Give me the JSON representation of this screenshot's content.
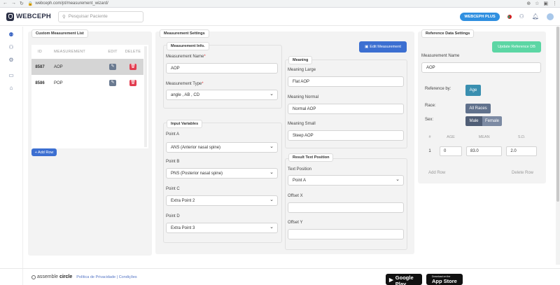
{
  "browser": {
    "url": "webceph.com/pt/measurement_wizard/"
  },
  "header": {
    "logo": "WEBCEPH",
    "search_placeholder": "Pesquisar Paciente",
    "plus_badge": "WEBCEPH PLUS"
  },
  "custom_list": {
    "title": "Custom Measurement List",
    "columns": [
      "ID",
      "MEASUREMENT",
      "EDIT",
      "DELETE"
    ],
    "rows": [
      {
        "id": "8587",
        "name": "AOP"
      },
      {
        "id": "8586",
        "name": "POP"
      }
    ],
    "add_row": "+ Add Row"
  },
  "settings": {
    "title": "Measurement Settings",
    "edit_button": "Edit Measurement",
    "info": {
      "title": "Measurement Info.",
      "name_label": "Measurement Name",
      "name_value": "AOP",
      "type_label": "Measurement Type",
      "type_value": "angle , AB , CD"
    },
    "input_vars": {
      "title": "Input Variables",
      "fields": [
        {
          "label": "Point A",
          "value": "ANS (Anterior nasal spine)"
        },
        {
          "label": "Point B",
          "value": "PNS (Posterior nasal spine)"
        },
        {
          "label": "Point C",
          "value": "Extra Point 2"
        },
        {
          "label": "Point D",
          "value": "Extra Point 3"
        }
      ]
    },
    "meaning": {
      "title": "Meaning",
      "large_label": "Meaning Large",
      "large_value": "Flat AOP",
      "normal_label": "Meaning Normal",
      "normal_value": "Normal AOP",
      "small_label": "Meaning Small",
      "small_value": "Steep AOP"
    },
    "result": {
      "title": "Result Text Position",
      "text_label": "Text Position",
      "text_value": "Point A",
      "offx_label": "Offset X",
      "offx_value": "",
      "offy_label": "Offset Y",
      "offy_value": ""
    }
  },
  "reference": {
    "title": "Reference Data Settings",
    "update_button": "Update Reference DB",
    "name_label": "Measurement Name",
    "name_value": "AOP",
    "ref_by_label": "Reference by:",
    "ref_by_value": "Age",
    "race_label": "Race:",
    "race_value": "All Races",
    "sex_label": "Sex:",
    "sex_male": "Male",
    "sex_female": "Female",
    "columns": [
      "#",
      "AGE",
      "MEAN",
      "S.D."
    ],
    "rows": [
      {
        "n": "1",
        "age": "0",
        "mean": "83.0",
        "sd": "2.0"
      }
    ],
    "add_row": "Add Row",
    "delete_row": "Delete Row"
  },
  "footer": {
    "brand_a": "assemble",
    "brand_b": "circle",
    "links": "Política de Privacidade | Condições",
    "google_small": "GET IT ON",
    "google": "Google Play",
    "apple_small": "Download on the",
    "apple": "App Store"
  },
  "colors": {
    "blue": "#3c6fd1",
    "green": "#5cd6a4",
    "teal": "#3a8fb0",
    "red": "#e23c4f"
  }
}
